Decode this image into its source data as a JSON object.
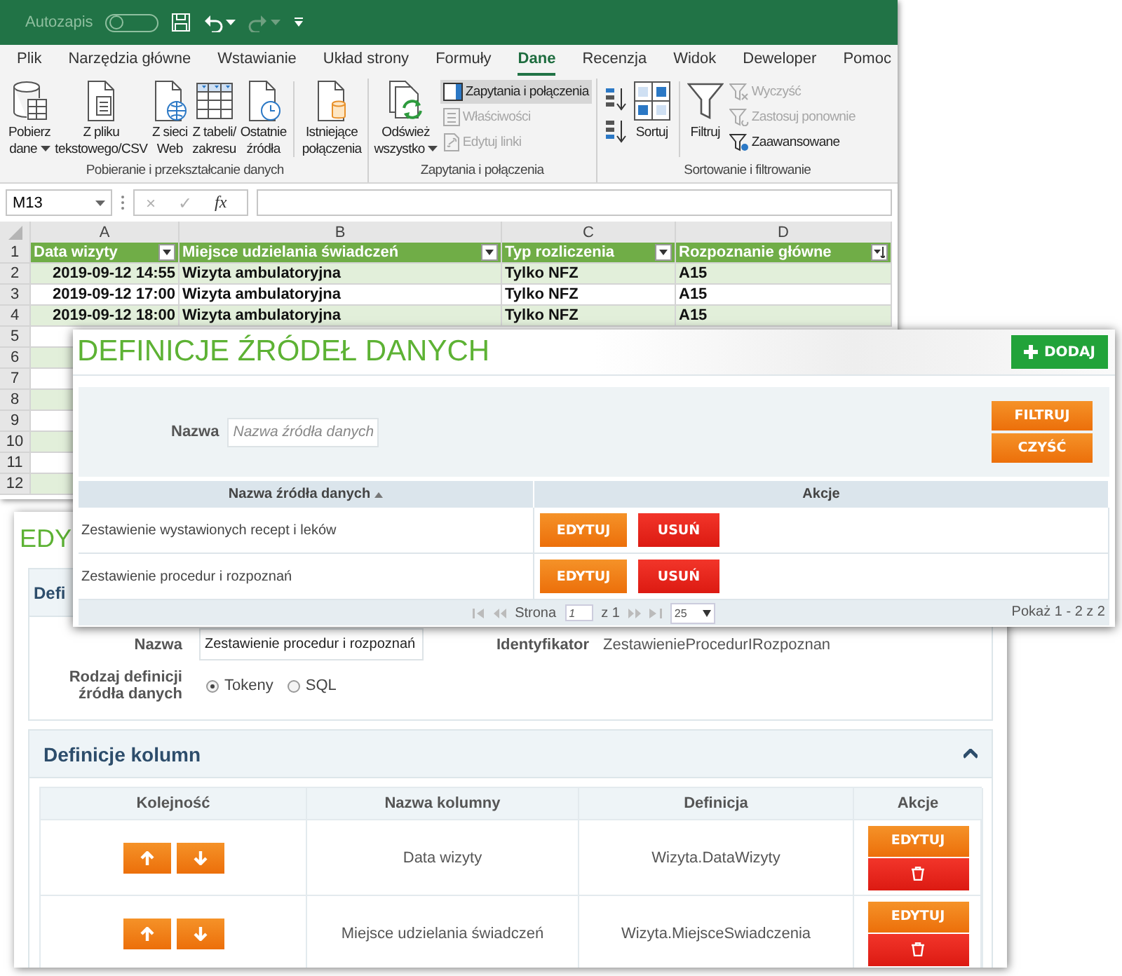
{
  "excel": {
    "quick_access": {
      "autosave_label": "Autozapis",
      "autosave_on": false
    },
    "menu_tabs": [
      {
        "label": "Plik",
        "selected": false
      },
      {
        "label": "Narzędzia główne",
        "selected": false
      },
      {
        "label": "Wstawianie",
        "selected": false
      },
      {
        "label": "Układ strony",
        "selected": false
      },
      {
        "label": "Formuły",
        "selected": false
      },
      {
        "label": "Dane",
        "selected": true
      },
      {
        "label": "Recenzja",
        "selected": false
      },
      {
        "label": "Widok",
        "selected": false
      },
      {
        "label": "Deweloper",
        "selected": false
      },
      {
        "label": "Pomoc",
        "selected": false
      }
    ],
    "ribbon_groups": [
      {
        "label": "Pobieranie i przekształcanie danych",
        "items": [
          {
            "kind": "large",
            "lines": [
              "Pobierz",
              "dane"
            ],
            "dropdown": true
          },
          {
            "kind": "large",
            "lines": [
              "Z pliku",
              "tekstowego/CSV"
            ],
            "dropdown": false
          },
          {
            "kind": "large",
            "lines": [
              "Z sieci",
              "Web"
            ],
            "dropdown": false
          },
          {
            "kind": "large",
            "lines": [
              "Z tabeli/",
              "zakresu"
            ],
            "dropdown": false
          },
          {
            "kind": "large",
            "lines": [
              "Ostatnie",
              "źródła"
            ],
            "dropdown": false
          },
          {
            "kind": "separator"
          },
          {
            "kind": "large",
            "lines": [
              "Istniejące",
              "połączenia"
            ],
            "dropdown": false
          }
        ]
      },
      {
        "label": "Zapytania i połączenia",
        "items": [
          {
            "kind": "large",
            "lines": [
              "Odśwież",
              "wszystko"
            ],
            "dropdown": true
          },
          {
            "kind": "stack",
            "entries": [
              {
                "label": "Zapytania i połączenia",
                "selected": true,
                "disabled": false
              },
              {
                "label": "Właściwości",
                "selected": false,
                "disabled": true
              },
              {
                "label": "Edytuj linki",
                "selected": false,
                "disabled": true
              }
            ]
          }
        ]
      },
      {
        "label": "Sortowanie i filtrowanie",
        "items": [
          {
            "kind": "sort_pair"
          },
          {
            "kind": "large",
            "lines": [
              "Sortuj"
            ],
            "dropdown": false
          },
          {
            "kind": "separator"
          },
          {
            "kind": "large",
            "lines": [
              "Filtruj"
            ],
            "dropdown": false
          },
          {
            "kind": "stack",
            "entries": [
              {
                "label": "Wyczyść",
                "selected": false,
                "disabled": true
              },
              {
                "label": "Zastosuj ponownie",
                "selected": false,
                "disabled": true
              },
              {
                "label": "Zaawansowane",
                "selected": false,
                "disabled": false
              }
            ]
          }
        ]
      }
    ],
    "name_box": "M13",
    "formula_buttons": [
      {
        "label": "×",
        "disabled": true
      },
      {
        "label": "✓",
        "disabled": true
      },
      {
        "label": "fx",
        "disabled": false
      }
    ],
    "sheet": {
      "columns": [
        {
          "letter": "A",
          "header": "Data wizyty",
          "sorted": false
        },
        {
          "letter": "B",
          "header": "Miejsce udzielania świadczeń",
          "sorted": false
        },
        {
          "letter": "C",
          "header": "Typ rozliczenia",
          "sorted": false
        },
        {
          "letter": "D",
          "header": "Rozpoznanie główne",
          "sorted": true
        }
      ],
      "header_row_number": "1",
      "rows": [
        {
          "number": "2",
          "cells": [
            "2019-09-12 14:55",
            "Wizyta ambulatoryjna",
            "Tylko NFZ",
            "A15"
          ]
        },
        {
          "number": "3",
          "cells": [
            "2019-09-12 17:00",
            "Wizyta ambulatoryjna",
            "Tylko NFZ",
            "A15"
          ]
        },
        {
          "number": "4",
          "cells": [
            "2019-09-12 18:00",
            "Wizyta ambulatoryjna",
            "Tylko NFZ",
            "A15"
          ]
        },
        {
          "number": "5"
        },
        {
          "number": "6"
        },
        {
          "number": "7"
        },
        {
          "number": "8"
        },
        {
          "number": "9"
        },
        {
          "number": "10"
        },
        {
          "number": "11"
        },
        {
          "number": "12"
        }
      ]
    }
  },
  "editor": {
    "title": "EDY",
    "details": {
      "title": "Defi",
      "name_label": "Nazwa",
      "name_value": "Zestawienie procedur i rozpoznań",
      "id_label": "Identyfikator",
      "id_value": "ZestawienieProcedurIRozpoznan",
      "type_label": "Rodzaj definicji źródła danych",
      "type_options": [
        {
          "label": "Tokeny",
          "selected": true
        },
        {
          "label": "SQL",
          "selected": false
        }
      ]
    },
    "columns_section": {
      "title": "Definicje kolumn",
      "expanded": true,
      "columns": [
        "Kolejność",
        "Nazwa kolumny",
        "Definicja",
        "Akcje"
      ],
      "rows": [
        {
          "name": "Data wizyty",
          "definition": "Wizyta.DataWizyty",
          "edit": "EDYTUJ"
        },
        {
          "name": "Miejsce udzielania świadczeń",
          "definition": "Wizyta.MiejsceSwiadczenia",
          "edit": "EDYTUJ"
        }
      ]
    }
  },
  "sources_dialog": {
    "title": "DEFINICJE ŹRÓDEŁ DANYCH",
    "add_button": "DODAJ",
    "filter": {
      "label": "Nazwa",
      "placeholder": "Nazwa źródła danych",
      "buttons": [
        "FILTRUJ",
        "CZYŚĆ"
      ]
    },
    "columns": [
      {
        "label": "Nazwa źródła danych",
        "sorted": true
      },
      {
        "label": "Akcje",
        "sorted": false
      }
    ],
    "rows": [
      {
        "name": "Zestawienie wystawionych recept i leków",
        "edit": "EDYTUJ",
        "delete": "USUŃ"
      },
      {
        "name": "Zestawienie procedur i rozpoznań",
        "edit": "EDYTUJ",
        "delete": "USUŃ"
      }
    ],
    "pager": {
      "page_label": "Strona",
      "page": "1",
      "of": "z 1",
      "page_size": "25",
      "summary": "Pokaż 1 - 2 z 2"
    }
  }
}
